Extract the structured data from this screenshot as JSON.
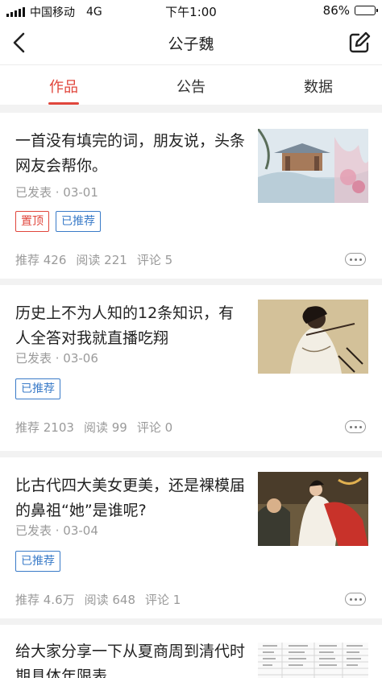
{
  "status_bar": {
    "carrier": "中国移动",
    "network": "4G",
    "time": "下午1:00",
    "battery": "86%",
    "battery_level": 0.86
  },
  "nav": {
    "title": "公子魏",
    "back_icon": "back-arrow-icon",
    "edit_icon": "edit-icon"
  },
  "tabs": [
    {
      "label": "作品",
      "active": true
    },
    {
      "label": "公告",
      "active": false
    },
    {
      "label": "数据",
      "active": false
    }
  ],
  "articles": [
    {
      "title": "一首没有填完的词，朋友说，头条网友会帮你。",
      "status": "已发表 · 03-01",
      "tags": [
        "置顶",
        "已推荐"
      ],
      "stats": {
        "recommend": "推荐 426",
        "read": "阅读 221",
        "comment": "评论 5"
      }
    },
    {
      "title": "历史上不为人知的12条知识，有人全答对我就直播吃翔",
      "status": "已发表 · 03-06",
      "tags": [
        "已推荐"
      ],
      "stats": {
        "recommend": "推荐 2103",
        "read": "阅读 99",
        "comment": "评论 0"
      }
    },
    {
      "title": "比古代四大美女更美，还是裸模届的鼻祖“她”是谁呢?",
      "status": "已发表 · 03-04",
      "tags": [
        "已推荐"
      ],
      "stats": {
        "recommend": "推荐 4.6万",
        "read": "阅读 648",
        "comment": "评论 1"
      }
    },
    {
      "title": "给大家分享一下从夏商周到清代时期具体年限表"
    }
  ],
  "colors": {
    "accent": "#e0463c",
    "recommend_tag": "#3a7bc8",
    "meta_text": "#9a9a9a"
  }
}
